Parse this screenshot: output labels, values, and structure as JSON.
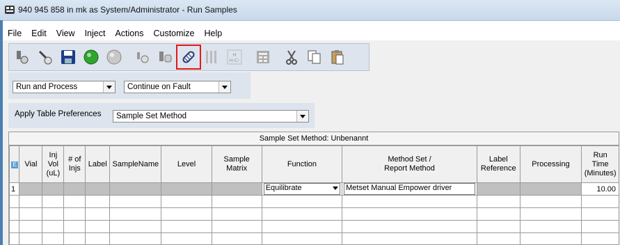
{
  "window": {
    "title": "940 945 858 in mk as System/Administrator - Run Samples"
  },
  "menu": [
    "File",
    "Edit",
    "View",
    "Inject",
    "Actions",
    "Customize",
    "Help"
  ],
  "toolbar": {
    "buttons": [
      "flask-icon",
      "wand-icon",
      "save-icon",
      "start-run-icon",
      "stop-run-icon",
      "vial-icon",
      "bottles-icon",
      "link-icon",
      "column-icon",
      "hc-icon",
      "grid-icon",
      "cut-icon",
      "copy-icon",
      "paste-icon"
    ],
    "highlighted": "link-icon"
  },
  "options": {
    "run_mode": "Run and Process",
    "fault_mode": "Continue on Fault"
  },
  "table_pref": {
    "label": "Apply Table Preferences",
    "value": "Sample Set Method"
  },
  "grid": {
    "title": "Sample Set Method: Unbenannt",
    "headers": {
      "vial": "Vial",
      "inj_vol": [
        "Inj",
        "Vol",
        "(uL)"
      ],
      "num_injs": [
        "# of",
        "Injs"
      ],
      "label": "Label",
      "sample_name": "SampleName",
      "level": "Level",
      "sample_matrix": "Sample Matrix",
      "function": "Function",
      "method_set": [
        "Method Set /",
        "Report Method"
      ],
      "label_reference": [
        "Label",
        "Reference"
      ],
      "processing": "Processing",
      "run_time": [
        "Run",
        "Time",
        "(Minutes)"
      ]
    },
    "row1": {
      "index": "1",
      "function": "Equilibrate",
      "method_set": "Metset Manual Empower driver",
      "run_time": "10.00"
    }
  }
}
